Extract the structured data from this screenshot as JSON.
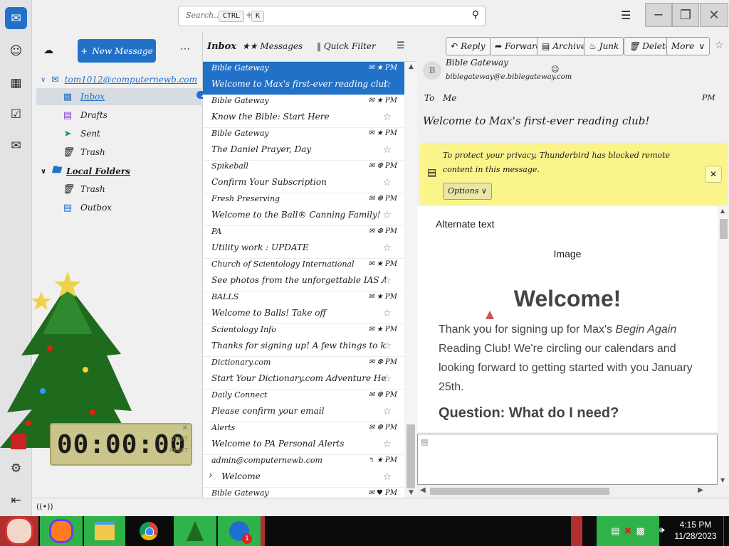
{
  "search": {
    "placeholder": "Search...",
    "key1": "CTRL",
    "key2": "K"
  },
  "folderpane": {
    "new_message": "New Message",
    "account": "tom1012@computernewb.com",
    "inbox": "Inbox",
    "drafts": "Drafts",
    "sent": "Sent",
    "trash": "Trash",
    "local_folders": "Local Folders",
    "local_trash": "Trash",
    "outbox": "Outbox"
  },
  "threadpane": {
    "tab_inbox": "Inbox",
    "tab_messages": "Messages",
    "quick_filter": "Quick Filter",
    "rows": [
      {
        "sender": "Bible Gateway",
        "subject": "Welcome to Max's first-ever reading club!",
        "time": "PM"
      },
      {
        "sender": "Bible Gateway",
        "subject": "Know the Bible: Start Here",
        "time": "PM"
      },
      {
        "sender": "Bible Gateway",
        "subject": "The Daniel Prayer, Day",
        "time": "PM"
      },
      {
        "sender": "Spikeball",
        "subject": "Confirm Your Subscription",
        "time": "PM"
      },
      {
        "sender": "Fresh Preserving",
        "subject": "Welcome to the Ball® Canning Family!",
        "time": "PM"
      },
      {
        "sender": "PA",
        "subject": "Utility work : UPDATE",
        "time": "PM"
      },
      {
        "sender": "Church of Scientology International",
        "subject": "See photos from the unforgettable IAS Anniv...",
        "time": "PM"
      },
      {
        "sender": "BALLS",
        "subject": "Welcome to Balls! Take off",
        "time": "PM"
      },
      {
        "sender": "Scientology Info",
        "subject": "Thanks for signing up! A few things to know...",
        "time": "PM"
      },
      {
        "sender": "Dictionary.com",
        "subject": "Start Your Dictionary.com Adventure Here!",
        "time": "PM"
      },
      {
        "sender": "Daily Connect",
        "subject": "Please confirm your email",
        "time": "PM"
      },
      {
        "sender": "Alerts",
        "subject": "Welcome to PA Personal Alerts",
        "time": "PM"
      },
      {
        "sender": "admin@computernewb.com",
        "subject": "Welcome",
        "time": "PM"
      },
      {
        "sender": "Bible Gateway",
        "subject": "",
        "time": "PM"
      }
    ]
  },
  "message": {
    "toolbar": {
      "reply": "Reply",
      "forward": "Forward",
      "archive": "Archive",
      "junk": "Junk",
      "delete": "Delete",
      "more": "More"
    },
    "from_name": "Bible Gateway",
    "from_email": "biblegateway@e.biblegateway.com",
    "to_label": "To",
    "to_value": "Me",
    "time": "PM",
    "subject": "Welcome to Max's first-ever reading club!",
    "notice_text": "To protect your privacy, Thunderbird has blocked remote content in this message.",
    "options": "Options",
    "body": {
      "alt_text": "Alternate text",
      "image_label": "Image",
      "heading": "Welcome!",
      "para_before": "Thank you for signing up for Max's ",
      "para_em": "Begin Again",
      "para_after": " Reading Club! We're circling our calendars and looking forward to getting started with you January 25th.",
      "question": "Question: What do I need?"
    }
  },
  "clock": {
    "time": "00:00:00",
    "start": "START",
    "reset": "RESET"
  },
  "taskbar": {
    "time": "4:15 PM",
    "date": "11/28/2023",
    "badge": "1"
  },
  "colors": {
    "accent": "#2271c9",
    "notice": "#fbf48b",
    "taskbar": "#0b0b0b"
  }
}
